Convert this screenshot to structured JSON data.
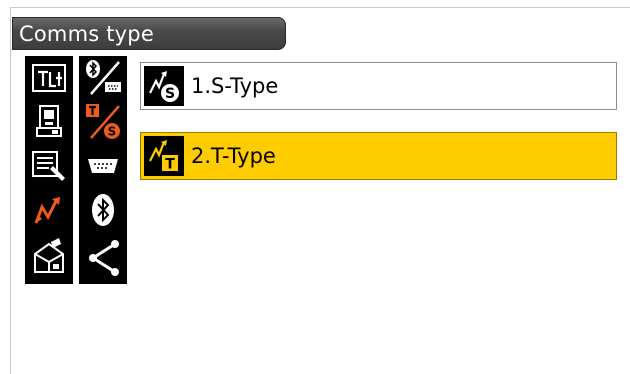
{
  "screen": {
    "title": "Comms type"
  },
  "left_panel": {
    "icons": [
      {
        "name": "observation-mode-icon"
      },
      {
        "name": "instrument-icon"
      },
      {
        "name": "data-editing-icon"
      },
      {
        "name": "communication-icon"
      },
      {
        "name": "usb-storage-icon"
      }
    ]
  },
  "right_panel": {
    "icons": [
      {
        "name": "bluetooth-rs232c-icon"
      },
      {
        "name": "t-to-s-type-icon"
      },
      {
        "name": "rs232c-port-icon"
      },
      {
        "name": "bluetooth-icon"
      },
      {
        "name": "network-share-icon"
      }
    ]
  },
  "options": [
    {
      "label": "1.S-Type",
      "badge": "S",
      "selected": false
    },
    {
      "label": "2.T-Type",
      "badge": "T",
      "selected": true
    }
  ],
  "colors": {
    "selected_bg": "#ffcc00",
    "icon_orange": "#f05a1e",
    "bar_dark": "#3d3d3d"
  }
}
